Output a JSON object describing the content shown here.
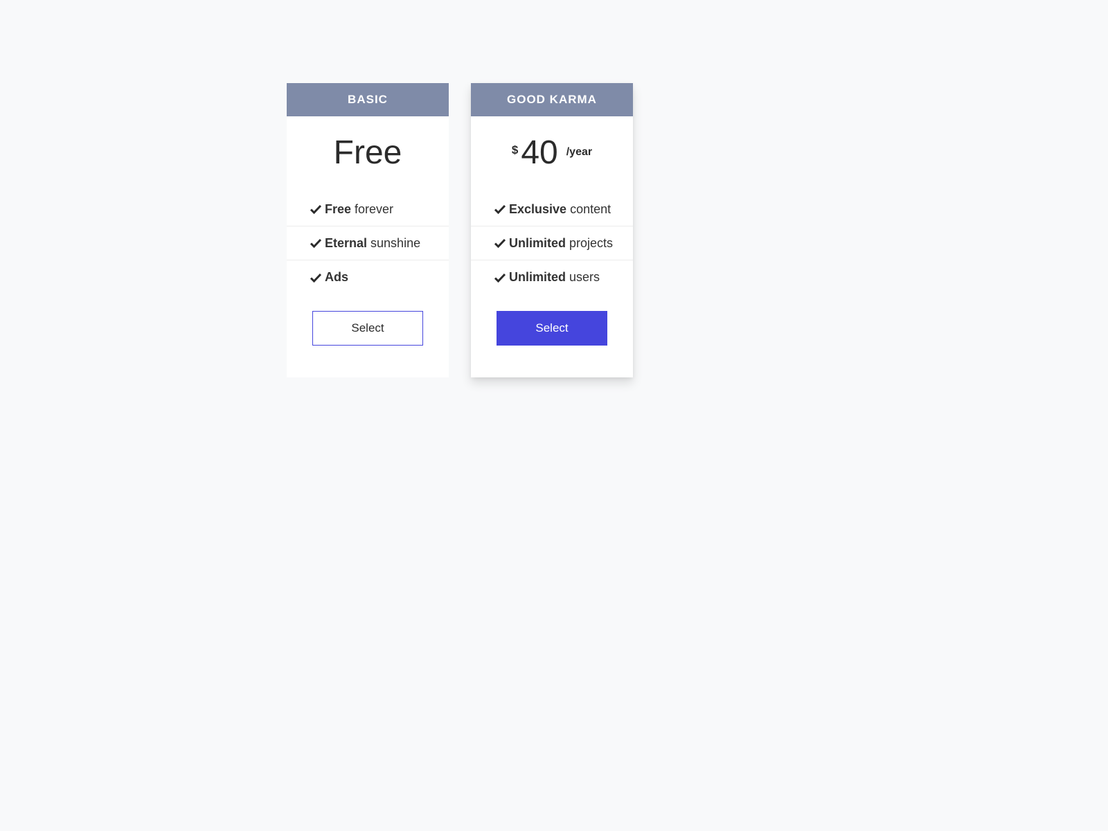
{
  "colors": {
    "header_bg": "#7f8ba8",
    "accent": "#4545dd",
    "page_bg": "#f8f9fa"
  },
  "plans": [
    {
      "title": "BASIC",
      "price_text": "Free",
      "features": [
        {
          "bold": "Free",
          "rest": "forever",
          "icon": "check-icon"
        },
        {
          "bold": "Eternal",
          "rest": "sunshine",
          "icon": "check-icon"
        },
        {
          "bold": "Ads",
          "rest": "",
          "icon": "check-icon"
        }
      ],
      "button_label": "Select"
    },
    {
      "title": "GOOD KARMA",
      "currency": "$",
      "amount": "40",
      "period": "/year",
      "features": [
        {
          "bold": "Exclusive",
          "rest": "content",
          "icon": "check-icon"
        },
        {
          "bold": "Unlimited",
          "rest": "projects",
          "icon": "check-icon"
        },
        {
          "bold": "Unlimited",
          "rest": "users",
          "icon": "check-icon"
        }
      ],
      "button_label": "Select"
    }
  ]
}
